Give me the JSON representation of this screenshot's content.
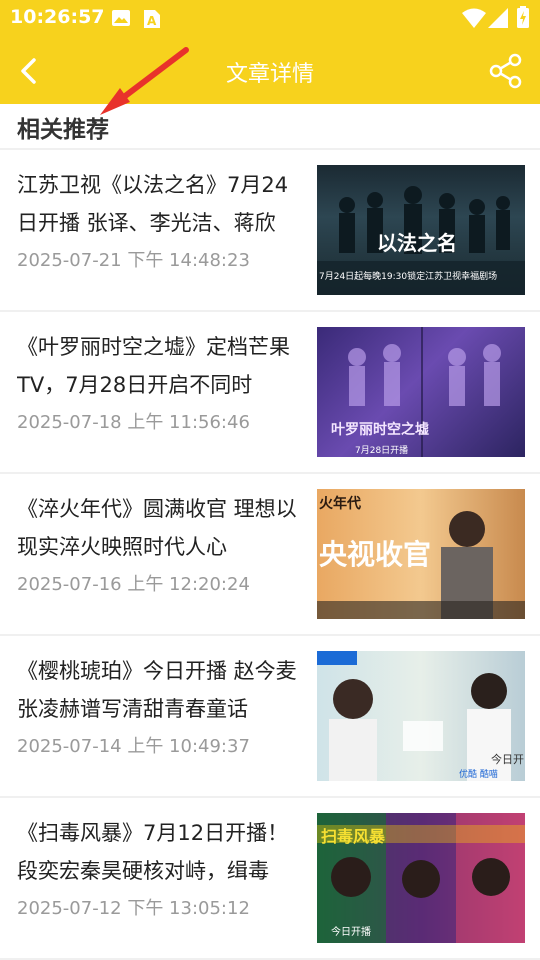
{
  "status_bar": {
    "time": "10:26:57",
    "icons": [
      "image-icon",
      "font-icon",
      "wifi-icon",
      "signal-icon",
      "battery-charging-icon"
    ]
  },
  "app_bar": {
    "title": "文章详情",
    "back_icon": "chevron-left-icon",
    "share_icon": "share-icon"
  },
  "section": {
    "title": "相关推荐"
  },
  "colors": {
    "accent": "#f7d21d",
    "annotation_arrow": "#e8322b"
  },
  "articles": [
    {
      "title": "江苏卫视《以法之名》7月24日开播 张译、李光洁、蒋欣",
      "date": "2025-07-21 下午 14:48:23",
      "thumb_title": "以法之名",
      "thumb_caption": "7月24日起每晚19:30锁定江苏卫视幸福剧场"
    },
    {
      "title": "《叶罗丽时空之墟》定档芒果TV，7月28日开启不同时",
      "date": "2025-07-18 上午 11:56:46",
      "thumb_title": "叶罗丽时空之墟",
      "thumb_caption": "7月28日开播"
    },
    {
      "title": "《淬火年代》圆满收官 理想以现实淬火映照时代人心",
      "date": "2025-07-16 上午 12:20:24",
      "thumb_title": "央视收官",
      "thumb_caption": "火年代"
    },
    {
      "title": "《樱桃琥珀》今日开播 赵今麦张凌赫谱写清甜青春童话",
      "date": "2025-07-14 上午 10:49:37",
      "thumb_title": "今日开",
      "thumb_caption": "优酷  酷喵"
    },
    {
      "title": "《扫毒风暴》7月12日开播！段奕宏秦昊硬核对峙，缉毒",
      "date": "2025-07-12 下午 13:05:12",
      "thumb_title": "扫毒风暴",
      "thumb_caption": "今日开播"
    }
  ]
}
